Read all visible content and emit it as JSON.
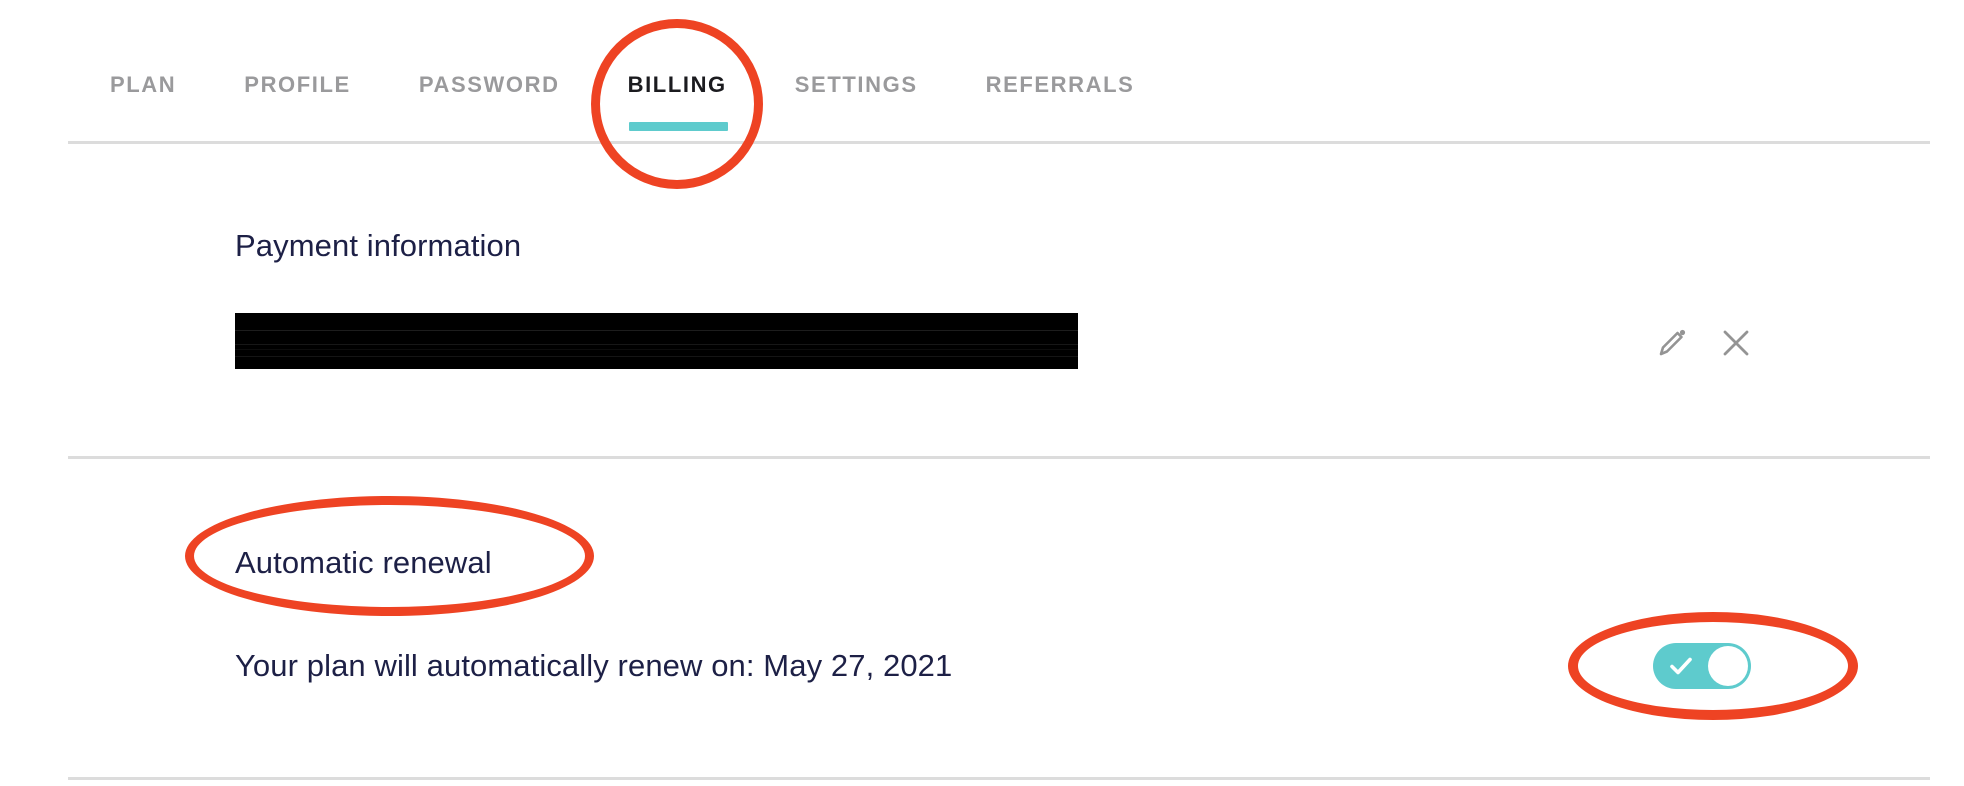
{
  "tabs": [
    {
      "label": "PLAN",
      "active": false
    },
    {
      "label": "PROFILE",
      "active": false
    },
    {
      "label": "PASSWORD",
      "active": false
    },
    {
      "label": "BILLING",
      "active": true
    },
    {
      "label": "SETTINGS",
      "active": false
    },
    {
      "label": "REFERRALS",
      "active": false
    }
  ],
  "payment_section": {
    "title": "Payment information",
    "redacted_value": "",
    "edit_icon": "pencil-icon",
    "remove_icon": "close-icon"
  },
  "renewal_section": {
    "title": "Automatic renewal",
    "description": "Your plan will automatically renew on: May 27, 2021",
    "toggle_state": "on",
    "toggle_icon": "check-icon"
  },
  "colors": {
    "accent_teal": "#5ecbcd",
    "annotation_red": "#ee4323",
    "heading_navy": "#1d2046",
    "tab_inactive": "#9a9a9c",
    "tab_active": "#1b1b1f",
    "divider": "#dcdcdc",
    "icon_gray": "#949494",
    "redaction": "#000000"
  },
  "annotations": [
    {
      "name": "billing-tab-circle",
      "shape": "circle"
    },
    {
      "name": "automatic-renewal-ellipse",
      "shape": "ellipse"
    },
    {
      "name": "renewal-toggle-ellipse",
      "shape": "ellipse"
    }
  ]
}
